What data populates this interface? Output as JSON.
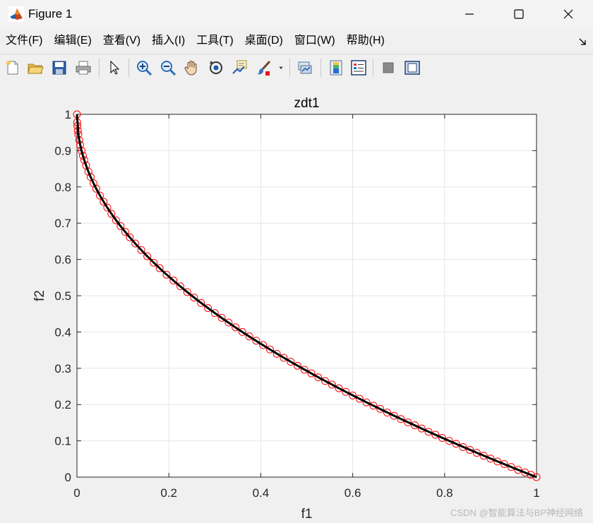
{
  "window": {
    "title": "Figure 1"
  },
  "menu": {
    "items": [
      "文件(F)",
      "编辑(E)",
      "查看(V)",
      "插入(I)",
      "工具(T)",
      "桌面(D)",
      "窗口(W)",
      "帮助(H)"
    ]
  },
  "toolbar": {
    "icons": [
      "new-figure-icon",
      "open-file-icon",
      "save-icon",
      "print-icon",
      "pointer-icon",
      "zoom-in-icon",
      "zoom-out-icon",
      "pan-hand-icon",
      "rotate-3d-icon",
      "data-cursor-icon",
      "brush-icon",
      "brush-dropdown-icon",
      "link-plot-icon",
      "colorbar-icon",
      "legend-icon",
      "hide-plot-tools-icon",
      "show-plot-tools-icon"
    ]
  },
  "watermark": "CSDN @智能算法与BP神经网络",
  "colors": {
    "marker": "#ff0000",
    "curve": "#000000",
    "grid": "#e6e6e6",
    "axes": "#262626"
  },
  "chart_data": {
    "type": "scatter",
    "title": "zdt1",
    "xlabel": "f1",
    "ylabel": "f2",
    "xlim": [
      0,
      1
    ],
    "ylim": [
      0,
      1
    ],
    "xticks": [
      "0",
      "0.2",
      "0.4",
      "0.6",
      "0.8",
      "1"
    ],
    "yticks": [
      "0",
      "0.1",
      "0.2",
      "0.3",
      "0.4",
      "0.5",
      "0.6",
      "0.7",
      "0.8",
      "0.9",
      "1"
    ],
    "grid": true,
    "series": [
      {
        "marker": "circle",
        "x": [
          0,
          0.0005,
          0.001,
          0.002,
          0.003,
          0.005,
          0.007,
          0.01,
          0.013,
          0.016,
          0.02,
          0.025,
          0.03,
          0.036,
          0.042,
          0.05,
          0.058,
          0.066,
          0.075,
          0.085,
          0.095,
          0.105,
          0.115,
          0.127,
          0.14,
          0.153,
          0.167,
          0.18,
          0.195,
          0.21,
          0.225,
          0.24,
          0.255,
          0.27,
          0.285,
          0.3,
          0.315,
          0.33,
          0.345,
          0.36,
          0.375,
          0.39,
          0.405,
          0.42,
          0.435,
          0.45,
          0.465,
          0.48,
          0.495,
          0.51,
          0.525,
          0.54,
          0.555,
          0.57,
          0.585,
          0.6,
          0.615,
          0.63,
          0.645,
          0.66,
          0.675,
          0.69,
          0.705,
          0.72,
          0.735,
          0.75,
          0.765,
          0.78,
          0.795,
          0.81,
          0.825,
          0.84,
          0.855,
          0.87,
          0.885,
          0.9,
          0.915,
          0.93,
          0.945,
          0.96,
          0.975,
          0.988,
          1
        ],
        "y": [
          1,
          0.978,
          0.968,
          0.955,
          0.945,
          0.929,
          0.916,
          0.9,
          0.886,
          0.874,
          0.859,
          0.842,
          0.827,
          0.81,
          0.795,
          0.776,
          0.759,
          0.743,
          0.726,
          0.708,
          0.692,
          0.676,
          0.661,
          0.644,
          0.626,
          0.609,
          0.591,
          0.576,
          0.558,
          0.542,
          0.526,
          0.51,
          0.495,
          0.48,
          0.466,
          0.452,
          0.439,
          0.426,
          0.413,
          0.4,
          0.388,
          0.376,
          0.364,
          0.352,
          0.34,
          0.329,
          0.318,
          0.307,
          0.296,
          0.286,
          0.275,
          0.265,
          0.255,
          0.245,
          0.235,
          0.225,
          0.216,
          0.206,
          0.197,
          0.188,
          0.178,
          0.169,
          0.16,
          0.151,
          0.143,
          0.134,
          0.125,
          0.117,
          0.108,
          0.1,
          0.092,
          0.083,
          0.075,
          0.067,
          0.059,
          0.051,
          0.043,
          0.036,
          0.028,
          0.02,
          0.013,
          0.006,
          0
        ]
      },
      {
        "marker": "line",
        "function": "1 - sqrt(x)"
      }
    ]
  }
}
